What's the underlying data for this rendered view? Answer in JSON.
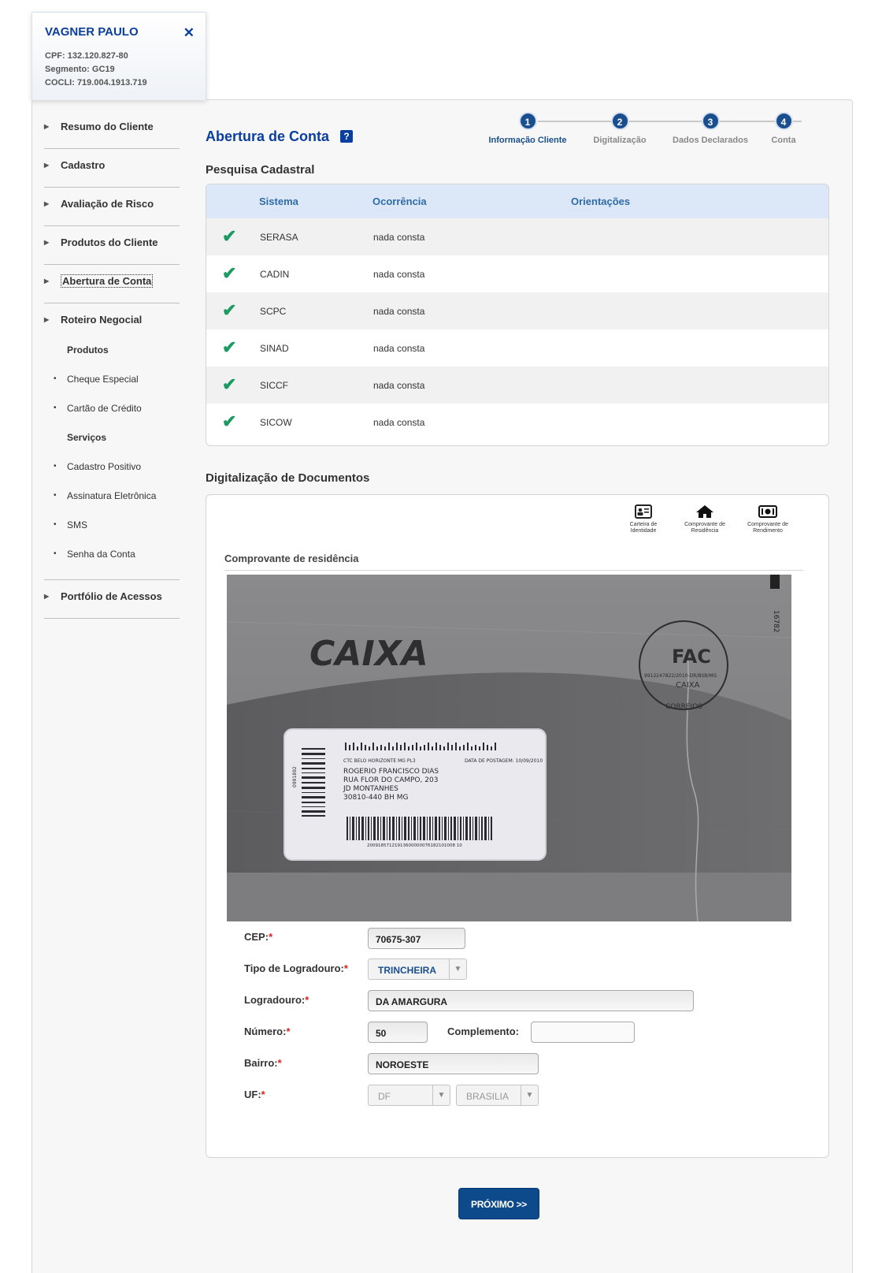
{
  "client": {
    "name": "VAGNER PAULO",
    "close": "✕",
    "cpf": "CPF: 132.120.827-80",
    "segmento": "Segmento: GC19",
    "cocli": "COCLI: 719.004.1913.719"
  },
  "sidebar": {
    "items": [
      {
        "label": "Resumo do Cliente"
      },
      {
        "label": "Cadastro"
      },
      {
        "label": "Avaliação de Risco"
      },
      {
        "label": "Produtos do Cliente"
      },
      {
        "label": "Abertura de Conta"
      }
    ],
    "roteiro": {
      "label": "Roteiro Negocial",
      "produtos_label": "Produtos",
      "produtos": [
        "Cheque Especial",
        "Cartão de Crédito"
      ],
      "servicos_label": "Serviços",
      "servicos": [
        "Cadastro Positivo",
        "Assinatura Eletrônica",
        "SMS",
        "Senha da Conta"
      ]
    },
    "portfolio": "Portfólio de Acessos"
  },
  "page": {
    "title": "Abertura de Conta",
    "help": "?"
  },
  "stepper": {
    "steps": [
      {
        "num": "1",
        "label": "Informação Cliente"
      },
      {
        "num": "2",
        "label": "Digitalização"
      },
      {
        "num": "3",
        "label": "Dados Declarados"
      },
      {
        "num": "4",
        "label": "Conta"
      }
    ]
  },
  "pesquisa": {
    "title": "Pesquisa Cadastral",
    "headers": {
      "sistema": "Sistema",
      "ocorrencia": "Ocorrência",
      "orientacoes": "Orientações"
    },
    "rows": [
      {
        "sistema": "SERASA",
        "ocorrencia": "nada consta"
      },
      {
        "sistema": "CADIN",
        "ocorrencia": "nada consta"
      },
      {
        "sistema": "SCPC",
        "ocorrencia": "nada consta"
      },
      {
        "sistema": "SINAD",
        "ocorrencia": "nada consta"
      },
      {
        "sistema": "SICCF",
        "ocorrencia": "nada consta"
      },
      {
        "sistema": "SICOW",
        "ocorrencia": "nada consta"
      }
    ]
  },
  "digitalizacao": {
    "title": "Digitalização de Documentos",
    "icons": [
      {
        "icon": "id-card-icon",
        "label1": "Carteira de",
        "label2": "Identidade"
      },
      {
        "icon": "home-icon",
        "label1": "Comprovante de",
        "label2": "Residência"
      },
      {
        "icon": "money-icon",
        "label1": "Comprovante de",
        "label2": "Rendimento"
      }
    ],
    "subtitle": "Comprovante de residência",
    "document": {
      "brand": "CAIXA",
      "stamp_top": "FAC",
      "stamp_mid": "9912247822/2010-DR/BSB/MG",
      "stamp_caixa": "CAIXA",
      "stamp_bottom": "CORREIOS",
      "side_code": "16782",
      "side_code2": "0991892",
      "ctc": "CTC BELO HORIZONTE MG PL3",
      "data_postagem": "DATA DE POSTAGEM: 10/09/2010",
      "addr1": "ROGERIO FRANCISCO DIAS",
      "addr2": "RUA FLOR DO CAMPO, 203",
      "addr3": "JD MONTANHES",
      "addr4": "30810-440 BH MG",
      "barcode_num": "20091857121913600000076182101008 10"
    }
  },
  "form": {
    "cep_label": "CEP:",
    "cep": "70675-307",
    "tipo_label": "Tipo de Logradouro:",
    "tipo": "TRINCHEIRA",
    "logradouro_label": "Logradouro:",
    "logradouro": "DA AMARGURA",
    "numero_label": "Número:",
    "numero": "50",
    "complemento_label": "Complemento:",
    "complemento": "",
    "bairro_label": "Bairro:",
    "bairro": "NOROESTE",
    "uf_label": "UF:",
    "uf": "DF",
    "cidade": "BRASILIA",
    "required_mark": "*",
    "caret": "▼"
  },
  "actions": {
    "next": "PRÓXIMO >>"
  },
  "colors": {
    "primary": "#0b3f9f",
    "check": "#1d9a63",
    "header_bg": "#dce8f7"
  }
}
